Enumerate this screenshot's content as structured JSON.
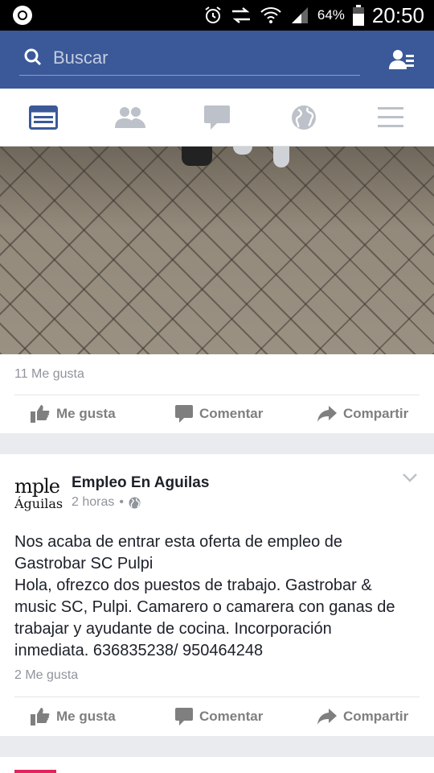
{
  "status_bar": {
    "battery": "64%",
    "time": "20:50"
  },
  "header": {
    "search_placeholder": "Buscar"
  },
  "nav": {
    "tabs": [
      {
        "icon": "news-feed-icon",
        "active": true
      },
      {
        "icon": "friends-icon",
        "active": false
      },
      {
        "icon": "messages-icon",
        "active": false
      },
      {
        "icon": "globe-icon",
        "active": false
      },
      {
        "icon": "menu-icon",
        "active": false
      }
    ]
  },
  "post1": {
    "likes": "11 Me gusta",
    "actions": {
      "like": "Me gusta",
      "comment": "Comentar",
      "share": "Compartir"
    }
  },
  "post2": {
    "page_name": "Empleo En Aguilas",
    "avatar_line1": "mple",
    "avatar_line2": "Águilas",
    "time": "2 horas",
    "separator": "•",
    "text_lines": [
      "Nos acaba de entrar esta oferta de empleo de",
      "Gastrobar SC Pulpi",
      "Hola, ofrezco dos puestos de trabajo. Gastrobar &",
      "music SC, Pulpi. Camarero o camarera con ganas de",
      "trabajar y ayudante de cocina. Incorporación",
      "inmediata. 636835238/ 950464248"
    ],
    "likes": "2 Me gusta",
    "actions": {
      "like": "Me gusta",
      "comment": "Comentar",
      "share": "Compartir"
    }
  },
  "colors": {
    "brand": "#3b5998",
    "muted": "#90949c",
    "action": "#7f7f7f"
  }
}
